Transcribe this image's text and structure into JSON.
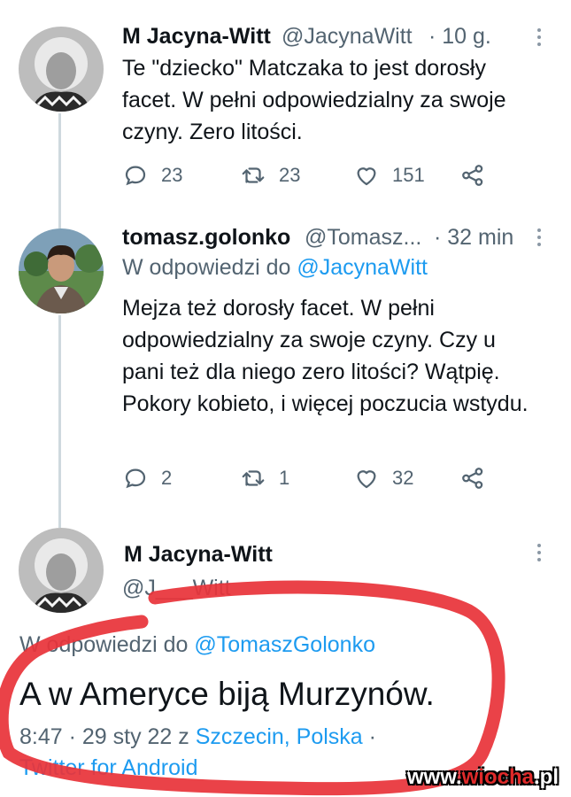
{
  "tweet1": {
    "display_name": "M Jacyna-Witt",
    "handle": "@JacynaWitt",
    "time": "· 10 g.",
    "text": "Te \"dziecko\" Matczaka to jest dorosły facet. W pełni odpowiedzialny za swoje czyny. Zero litości.",
    "replies": "23",
    "retweets": "23",
    "likes": "151"
  },
  "tweet2": {
    "display_name": "tomasz.golonko",
    "handle": "@Tomasz...",
    "time": "· 32 min",
    "reply_prefix": "W odpowiedzi do",
    "reply_to": "@JacynaWitt",
    "text": "Mejza też dorosły facet. W pełni odpowiedzialny za swoje czyny. Czy u pani też dla niego zero litości? Wątpię. Pokory kobieto, i więcej poczucia wstydu.",
    "replies": "2",
    "retweets": "1",
    "likes": "32"
  },
  "tweet3": {
    "display_name": "M Jacyna-Witt",
    "handle": "@J___Witt",
    "reply_prefix": "W odpowiedzi do",
    "reply_to": "@TomaszGolonko",
    "text": "A w Ameryce biją Murzynów.",
    "time_date": "8:47 · 29 sty 22 z",
    "location": "Szczecin, Polska",
    "separator": "·",
    "source": "Twitter for Android"
  },
  "watermark": {
    "prefix": "www.",
    "brand": "wiocha",
    "suffix": ".pl"
  },
  "colors": {
    "link": "#1d9bf0",
    "secondary": "#536471",
    "annotation": "#e8343a"
  }
}
